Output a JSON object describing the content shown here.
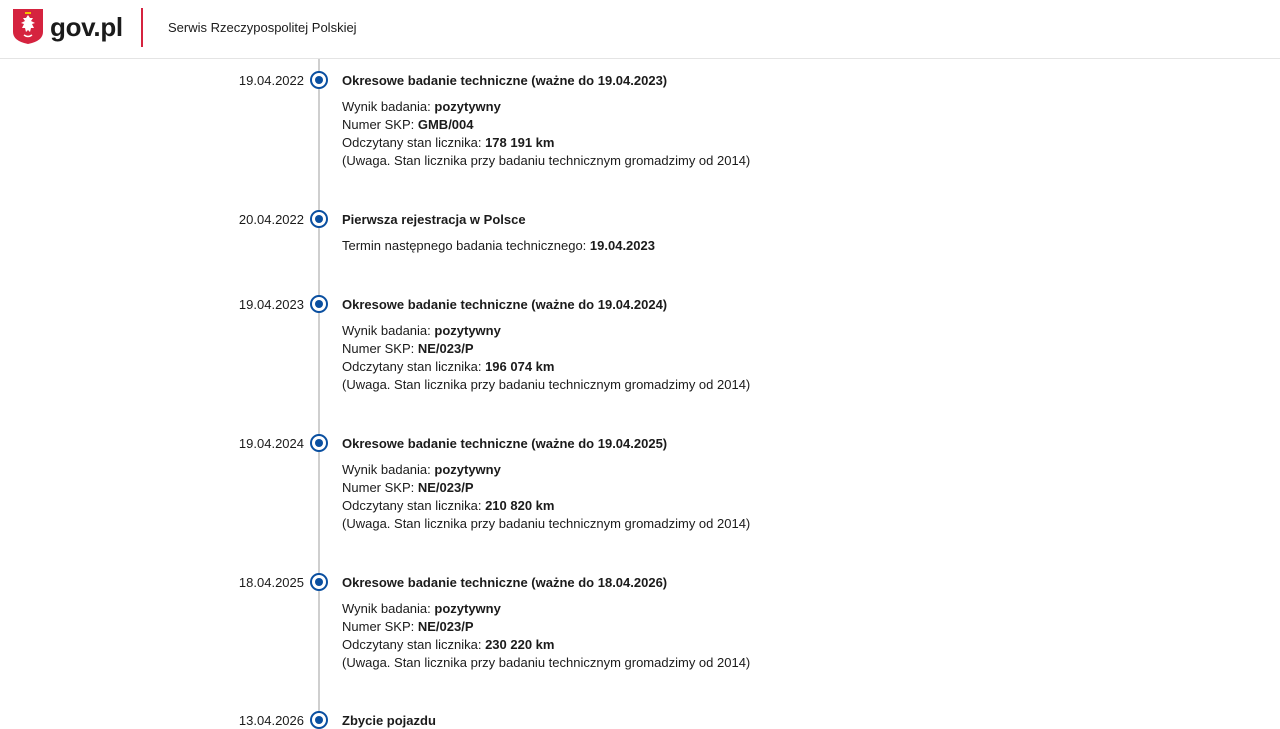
{
  "header": {
    "logo_text": "gov.pl",
    "service_name": "Serwis Rzeczypospolitej Polskiej"
  },
  "colors": {
    "accent_blue": "#0a4fa0",
    "divider_red": "#d5233f",
    "timeline_gray": "#cfcfcf"
  },
  "labels": {
    "result": "Wynik badania: ",
    "skp": "Numer SKP: ",
    "odometer": "Odczytany stan licznika: ",
    "note": "(Uwaga. Stan licznika przy badaniu technicznym gromadzimy od 2014)",
    "next_inspection": "Termin następnego badania technicznego: "
  },
  "events": [
    {
      "date": "19.04.2022",
      "title": "Okresowe badanie techniczne (ważne do 19.04.2023)",
      "result": "pozytywny",
      "skp": "GMB/004",
      "odometer": "178 191 km"
    },
    {
      "date": "20.04.2022",
      "title": "Pierwsza rejestracja w Polsce",
      "next_inspection": "19.04.2023"
    },
    {
      "date": "19.04.2023",
      "title": "Okresowe badanie techniczne (ważne do 19.04.2024)",
      "result": "pozytywny",
      "skp": "NE/023/P",
      "odometer": "196 074 km"
    },
    {
      "date": "19.04.2024",
      "title": "Okresowe badanie techniczne (ważne do 19.04.2025)",
      "result": "pozytywny",
      "skp": "NE/023/P",
      "odometer": "210 820 km"
    },
    {
      "date": "18.04.2025",
      "title": "Okresowe badanie techniczne (ważne do 18.04.2026)",
      "result": "pozytywny",
      "skp": "NE/023/P",
      "odometer": "230 220 km"
    },
    {
      "date": "13.04.2026",
      "title": "Zbycie pojazdu"
    }
  ]
}
